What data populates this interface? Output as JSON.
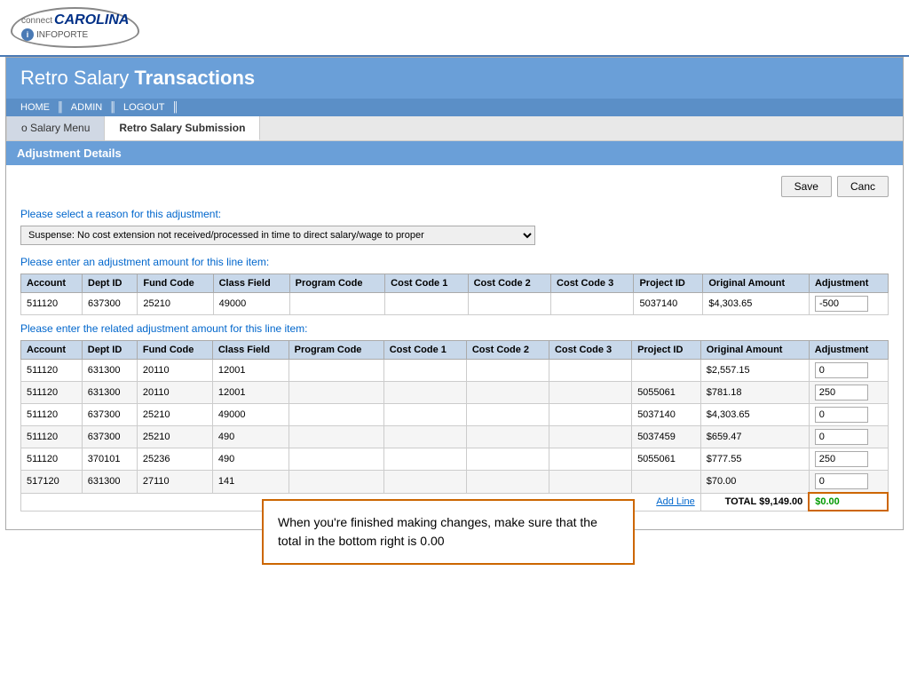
{
  "header": {
    "logo_connect": "connect",
    "logo_carolina": "CAROLINA",
    "logo_infoporte": "INFOPORTE",
    "logo_i": "i"
  },
  "title": {
    "retro": "Retro",
    "salary": "Salary",
    "transactions": "Transactions"
  },
  "nav": {
    "home": "HOME",
    "admin": "ADMIN",
    "logout": "LOGOUT"
  },
  "tabs": [
    {
      "label": "o Salary Menu",
      "active": false
    },
    {
      "label": "Retro Salary Submission",
      "active": true
    }
  ],
  "adjustment_details": {
    "header": "Adjustment Details",
    "save_btn": "Save",
    "cancel_btn": "Canc",
    "reason_label": "Please select a reason for this adjustment:",
    "reason_value": "Suspense: No cost extension not received/processed in time to direct salary/wage to proper",
    "reason_options": [
      "Suspense: No cost extension not received/processed in time to direct salary/wage to proper"
    ],
    "line_item_label": "Please enter an adjustment amount for this line item:",
    "table1": {
      "columns": [
        "Account",
        "Dept ID",
        "Fund Code",
        "Class Field",
        "Program Code",
        "Cost Code 1",
        "Cost Code 2",
        "Cost Code 3",
        "Project ID",
        "Original Amount",
        "Adjustment"
      ],
      "rows": [
        {
          "account": "511120",
          "dept_id": "637300",
          "fund_code": "25210",
          "class_field": "49000",
          "program_code": "",
          "cost_code1": "",
          "cost_code2": "",
          "cost_code3": "",
          "project_id": "5037140",
          "original_amount": "$4,303.65",
          "adjustment": "-500"
        }
      ]
    },
    "related_label": "Please enter the related adjustment amount for this line item:",
    "table2": {
      "columns": [
        "Account",
        "Dept ID",
        "Fund Code",
        "Class Field",
        "Program Code",
        "Cost Code 1",
        "Cost Code 2",
        "Cost Code 3",
        "Project ID",
        "Original Amount",
        "Adjustment"
      ],
      "rows": [
        {
          "account": "511120",
          "dept_id": "631300",
          "fund_code": "20110",
          "class_field": "12001",
          "program_code": "",
          "cost_code1": "",
          "cost_code2": "",
          "cost_code3": "",
          "project_id": "",
          "original_amount": "$2,557.15",
          "adjustment": "0"
        },
        {
          "account": "511120",
          "dept_id": "631300",
          "fund_code": "20110",
          "class_field": "12001",
          "program_code": "",
          "cost_code1": "",
          "cost_code2": "",
          "cost_code3": "",
          "project_id": "5055061",
          "original_amount": "$781.18",
          "adjustment": "250"
        },
        {
          "account": "511120",
          "dept_id": "637300",
          "fund_code": "25210",
          "class_field": "49000",
          "program_code": "",
          "cost_code1": "",
          "cost_code2": "",
          "cost_code3": "",
          "project_id": "5037140",
          "original_amount": "$4,303.65",
          "adjustment": "0"
        },
        {
          "account": "511120",
          "dept_id": "637300",
          "fund_code": "25210",
          "class_field": "490",
          "program_code": "",
          "cost_code1": "",
          "cost_code2": "",
          "cost_code3": "",
          "project_id": "5037459",
          "original_amount": "$659.47",
          "adjustment": "0"
        },
        {
          "account": "511120",
          "dept_id": "370101",
          "fund_code": "25236",
          "class_field": "490",
          "program_code": "",
          "cost_code1": "",
          "cost_code2": "",
          "cost_code3": "",
          "project_id": "5055061",
          "original_amount": "$777.55",
          "adjustment": "250"
        },
        {
          "account": "517120",
          "dept_id": "631300",
          "fund_code": "27110",
          "class_field": "141",
          "program_code": "",
          "cost_code1": "",
          "cost_code2": "",
          "cost_code3": "",
          "project_id": "",
          "original_amount": "$70.00",
          "adjustment": "0"
        }
      ],
      "add_line": "Add Line",
      "total_label": "TOTAL",
      "total_original": "$9,149.00",
      "total_adjustment": "$0.00"
    },
    "callout": "When you're finished making changes, make sure that the total in the bottom right is 0.00"
  }
}
